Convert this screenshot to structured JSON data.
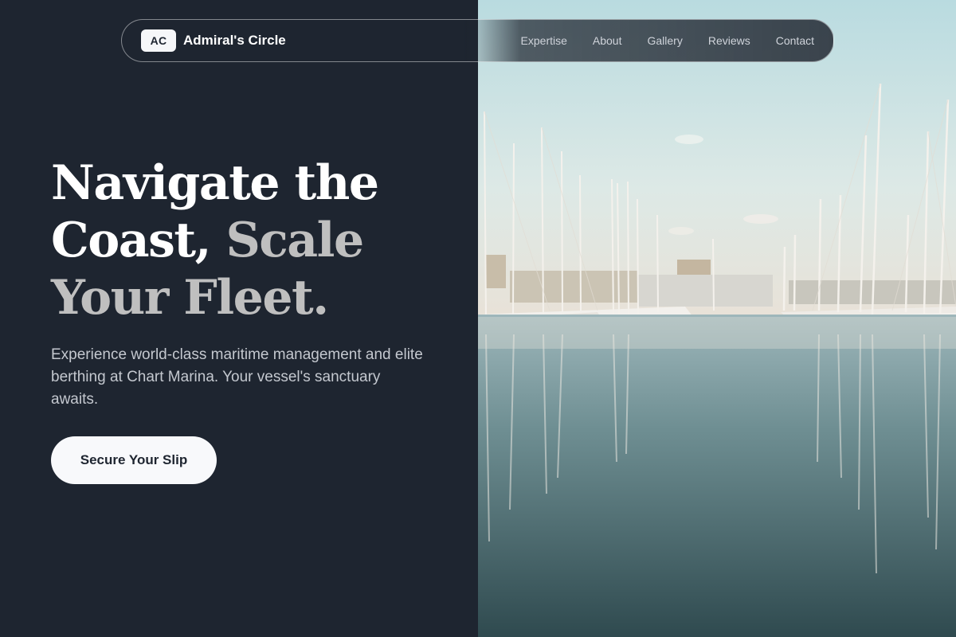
{
  "nav": {
    "logo_badge": "AC",
    "brand": "Admiral's Circle",
    "links": [
      "Expertise",
      "About",
      "Gallery",
      "Reviews",
      "Contact"
    ]
  },
  "hero": {
    "headline_line1": "Navigate the",
    "headline_line2a": "Coast,",
    "headline_line2b": "Scale",
    "headline_line3": "Your Fleet.",
    "subtext": "Experience world-class maritime management and elite berthing at Chart Marina. Your vessel's sanctuary awaits.",
    "cta_label": "Secure Your Slip"
  },
  "colors": {
    "background": "#1e2530",
    "accent_muted": "#bfbfbf",
    "button_bg": "#f8f9fb"
  },
  "image": {
    "subject": "marina-harbor-photo"
  }
}
